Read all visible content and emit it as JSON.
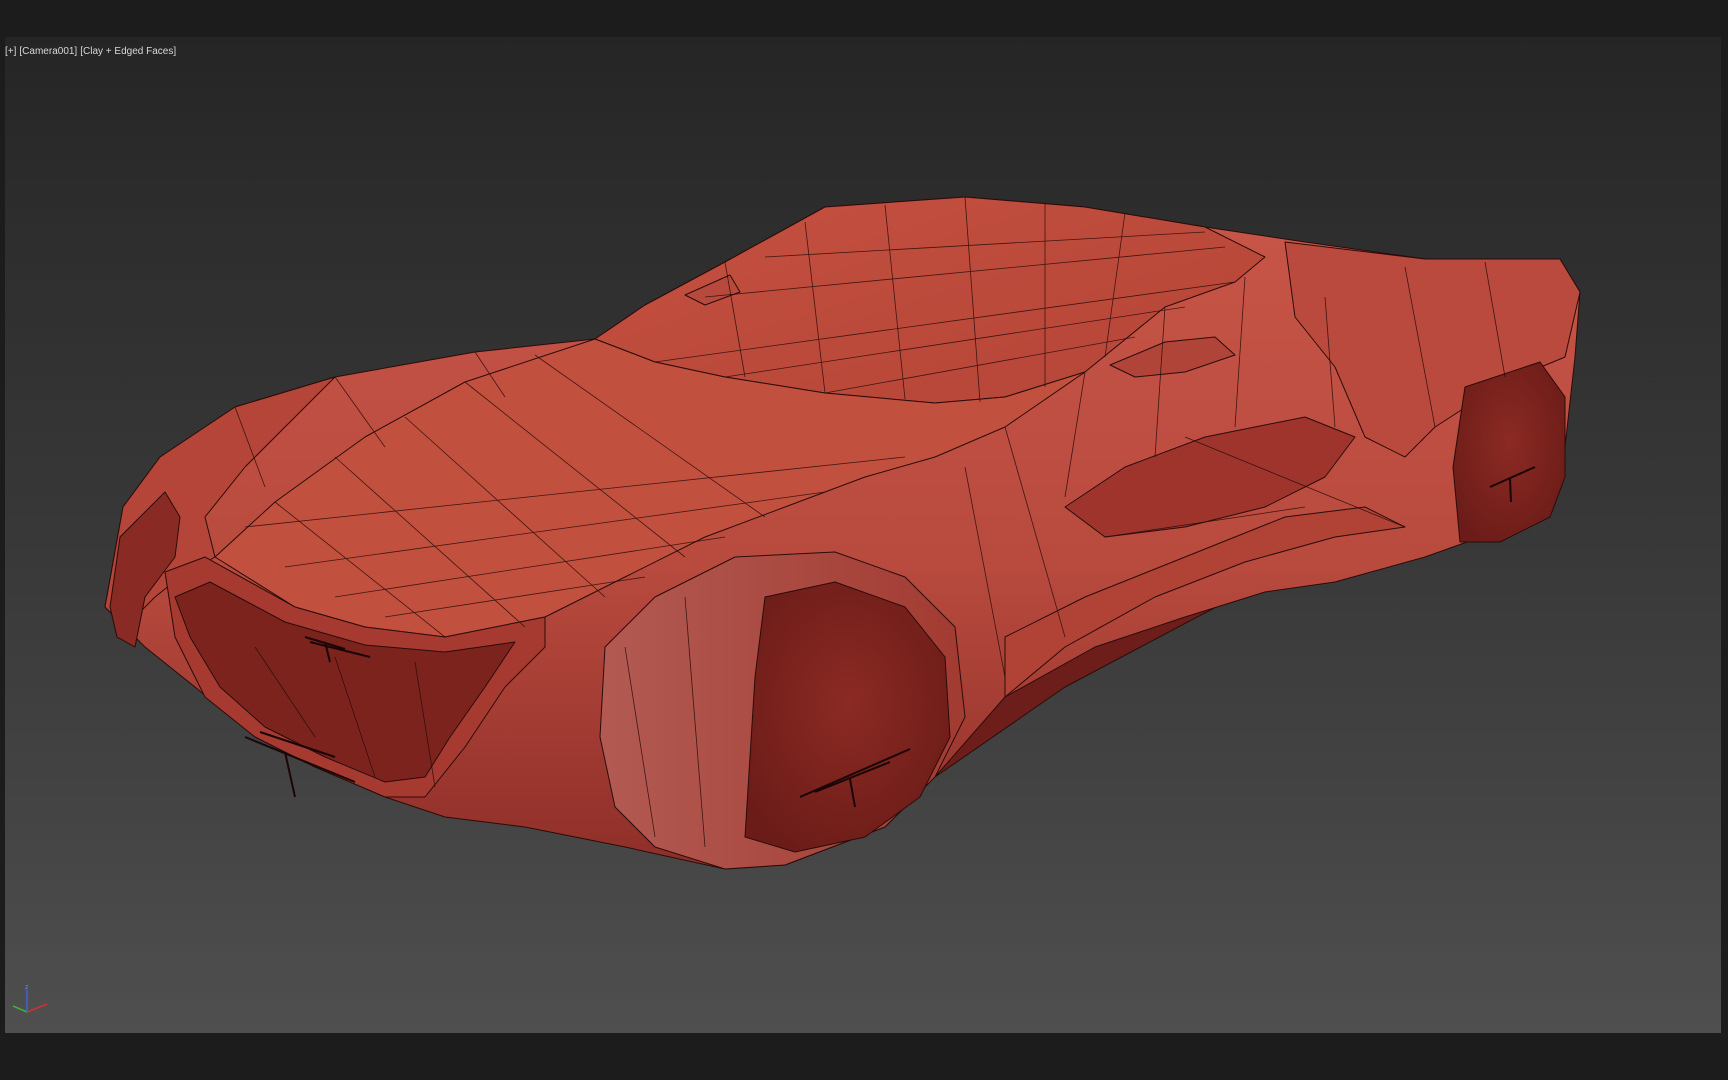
{
  "viewport": {
    "label_plus": "[+]",
    "label_camera": "[Camera001]",
    "label_shading": "[Clay + Edged Faces]",
    "axis_z": "z"
  },
  "colors": {
    "background": "#1c1c1c",
    "viewport_top": "#252525",
    "viewport_bottom": "#4f4f4f",
    "clay_light": "#c65446",
    "clay_mid": "#b2463a",
    "clay_dark": "#7f2520",
    "wire": "#2a0c0a",
    "axis_x": "#d03030",
    "axis_y": "#40b040",
    "axis_z": "#4060e0"
  }
}
